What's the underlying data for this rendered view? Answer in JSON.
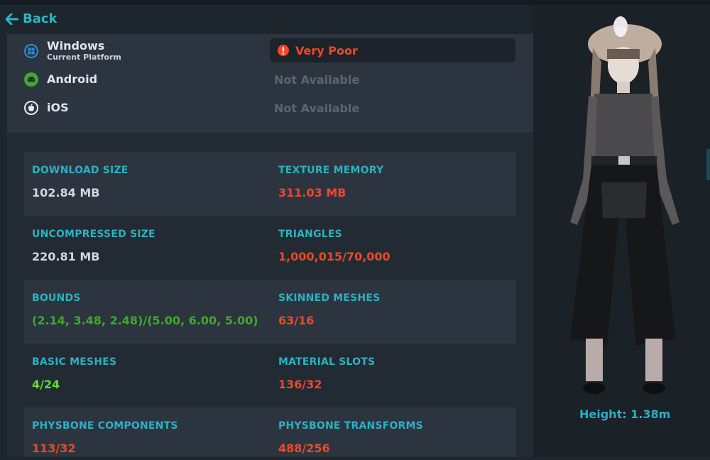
{
  "nav": {
    "back_label": "Back"
  },
  "platforms": [
    {
      "name": "Windows",
      "subtitle": "Current Platform",
      "icon": "windows-icon",
      "status": "Very Poor",
      "status_icon": "very-poor-icon"
    },
    {
      "name": "Android",
      "icon": "android-icon",
      "status": "Not Available"
    },
    {
      "name": "iOS",
      "icon": "apple-icon",
      "status": "Not Available"
    }
  ],
  "stats": [
    {
      "label": "DOWNLOAD SIZE",
      "value": "102.84 MB",
      "tone": "neutral"
    },
    {
      "label": "TEXTURE MEMORY",
      "value": "311.03 MB",
      "tone": "bad"
    },
    {
      "label": "UNCOMPRESSED SIZE",
      "value": "220.81 MB",
      "tone": "neutral"
    },
    {
      "label": "TRIANGLES",
      "value": "1,000,015/70,000",
      "tone": "bad"
    },
    {
      "label": "BOUNDS",
      "value": "(2.14, 3.48, 2.48)/(5.00, 6.00, 5.00)",
      "tone": "good"
    },
    {
      "label": "SKINNED MESHES",
      "value": "63/16",
      "tone": "bad"
    },
    {
      "label": "BASIC MESHES",
      "value": "4/24",
      "tone": "excellent"
    },
    {
      "label": "MATERIAL SLOTS",
      "value": "136/32",
      "tone": "bad"
    },
    {
      "label": "PHYSBONE COMPONENTS",
      "value": "113/32",
      "tone": "bad"
    },
    {
      "label": "PHYSBONE TRANSFORMS",
      "value": "488/256",
      "tone": "bad"
    }
  ],
  "avatar": {
    "height_label": "Height: 1.38m"
  },
  "colors": {
    "accent": "#2bb0c4",
    "bad": "#f2462a",
    "good": "#3fa82d",
    "excellent": "#5dde2c",
    "neutral": "#d3d8de"
  }
}
